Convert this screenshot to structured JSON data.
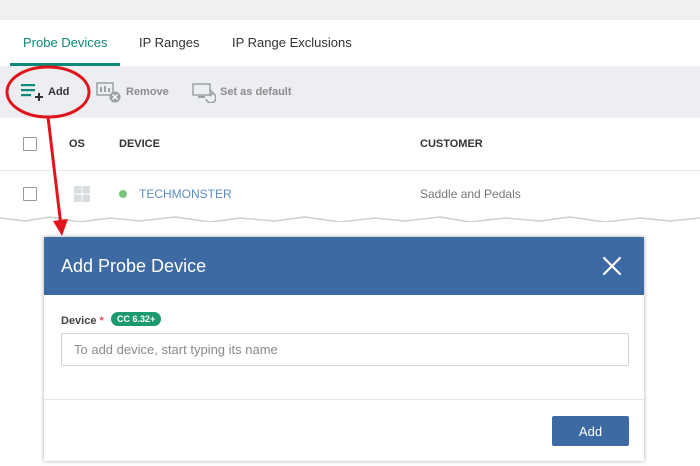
{
  "tabs": [
    {
      "label": "Probe Devices",
      "active": true
    },
    {
      "label": "IP Ranges",
      "active": false
    },
    {
      "label": "IP Range Exclusions",
      "active": false
    }
  ],
  "toolbar": {
    "add_label": "Add",
    "remove_label": "Remove",
    "set_default_label": "Set as default"
  },
  "table": {
    "columns": [
      "OS",
      "DEVICE",
      "CUSTOMER"
    ],
    "rows": [
      {
        "os_icon": "windows-icon",
        "status_color": "#7dc57a",
        "device": "TECHMONSTER",
        "customer": "Saddle and Pedals"
      }
    ]
  },
  "modal": {
    "title": "Add Probe Device",
    "field_label": "Device",
    "required_marker": "*",
    "badge": "CC 6.32+",
    "input_placeholder": "To add device, start typing its name",
    "input_value": "",
    "add_button": "Add"
  },
  "colors": {
    "accent_teal": "#0b8a7a",
    "modal_header": "#3d6aa3",
    "badge_green": "#1e9a70",
    "callout_red": "#e0151b",
    "link_blue": "#5d8cc4"
  }
}
